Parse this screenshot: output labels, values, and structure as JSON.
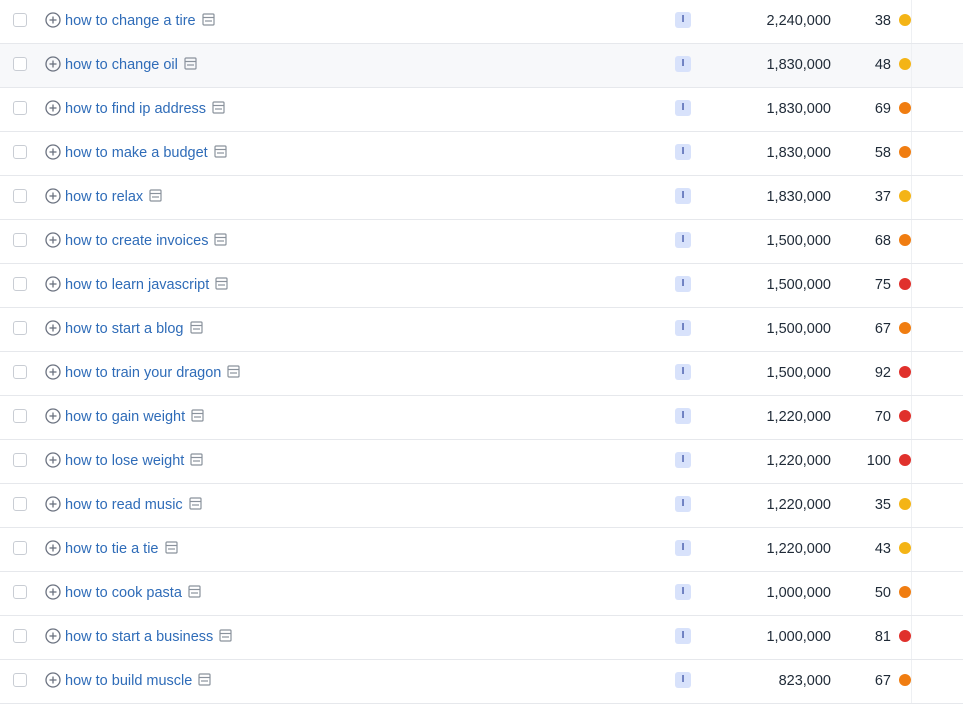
{
  "colors": {
    "link": "#2f6cb8",
    "intent_badge_bg": "#d8e2fb",
    "intent_badge_text": "#4a5fae",
    "kd_yellow": "#f4b416",
    "kd_orange": "#f07d11",
    "kd_red": "#e0312c"
  },
  "rows": [
    {
      "keyword": "how to change a tire",
      "intent": "I",
      "volume": "2,240,000",
      "kd": "38",
      "kd_color": "#f4b416"
    },
    {
      "keyword": "how to change oil",
      "intent": "I",
      "volume": "1,830,000",
      "kd": "48",
      "kd_color": "#f4b416"
    },
    {
      "keyword": "how to find ip address",
      "intent": "I",
      "volume": "1,830,000",
      "kd": "69",
      "kd_color": "#f07d11"
    },
    {
      "keyword": "how to make a budget",
      "intent": "I",
      "volume": "1,830,000",
      "kd": "58",
      "kd_color": "#f07d11"
    },
    {
      "keyword": "how to relax",
      "intent": "I",
      "volume": "1,830,000",
      "kd": "37",
      "kd_color": "#f4b416"
    },
    {
      "keyword": "how to create invoices",
      "intent": "I",
      "volume": "1,500,000",
      "kd": "68",
      "kd_color": "#f07d11"
    },
    {
      "keyword": "how to learn javascript",
      "intent": "I",
      "volume": "1,500,000",
      "kd": "75",
      "kd_color": "#e0312c"
    },
    {
      "keyword": "how to start a blog",
      "intent": "I",
      "volume": "1,500,000",
      "kd": "67",
      "kd_color": "#f07d11"
    },
    {
      "keyword": "how to train your dragon",
      "intent": "I",
      "volume": "1,500,000",
      "kd": "92",
      "kd_color": "#e0312c"
    },
    {
      "keyword": "how to gain weight",
      "intent": "I",
      "volume": "1,220,000",
      "kd": "70",
      "kd_color": "#e0312c"
    },
    {
      "keyword": "how to lose weight",
      "intent": "I",
      "volume": "1,220,000",
      "kd": "100",
      "kd_color": "#e0312c"
    },
    {
      "keyword": "how to read music",
      "intent": "I",
      "volume": "1,220,000",
      "kd": "35",
      "kd_color": "#f4b416"
    },
    {
      "keyword": "how to tie a tie",
      "intent": "I",
      "volume": "1,220,000",
      "kd": "43",
      "kd_color": "#f4b416"
    },
    {
      "keyword": "how to cook pasta",
      "intent": "I",
      "volume": "1,000,000",
      "kd": "50",
      "kd_color": "#f07d11"
    },
    {
      "keyword": "how to start a business",
      "intent": "I",
      "volume": "1,000,000",
      "kd": "81",
      "kd_color": "#e0312c"
    },
    {
      "keyword": "how to build muscle",
      "intent": "I",
      "volume": "823,000",
      "kd": "67",
      "kd_color": "#f07d11"
    }
  ]
}
